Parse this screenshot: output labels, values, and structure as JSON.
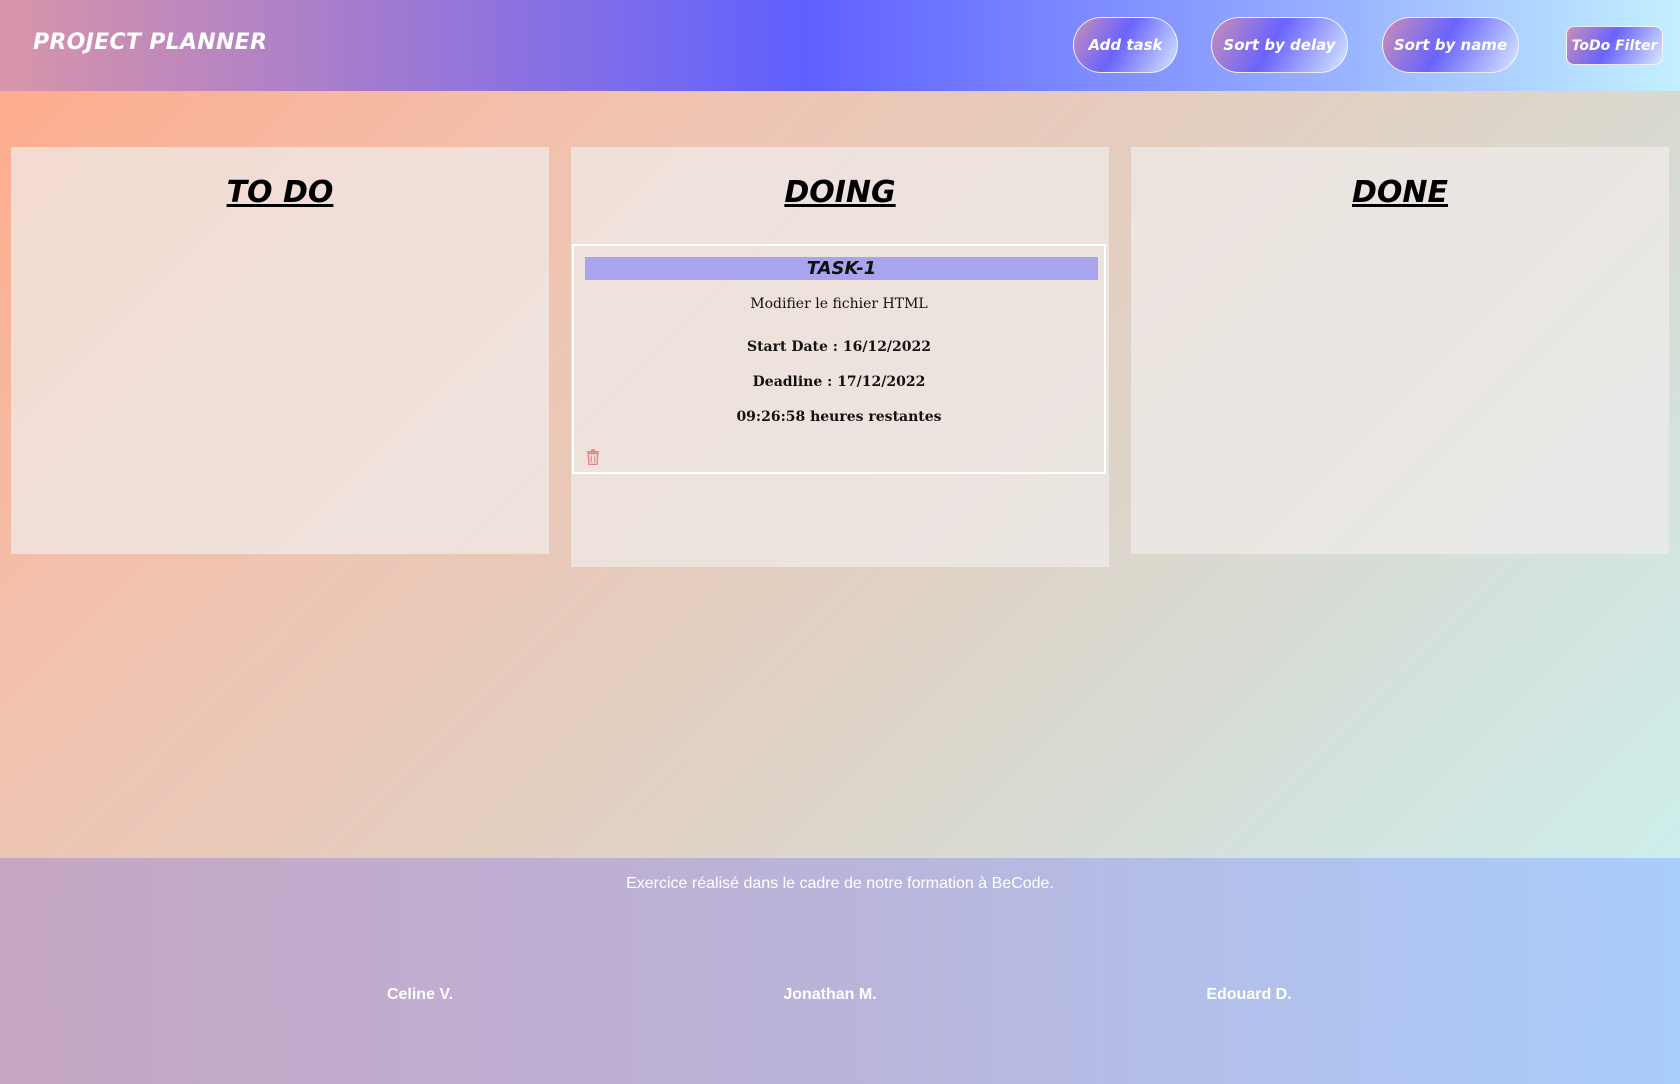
{
  "header": {
    "logo": "PROJECT PLANNER",
    "buttons": {
      "add_task": "Add task",
      "sort_delay": "Sort by delay",
      "sort_name": "Sort by name",
      "todo_filter": "ToDo Filter"
    }
  },
  "columns": {
    "todo": {
      "title": "TO DO"
    },
    "doing": {
      "title": "DOING",
      "tasks": [
        {
          "title": "TASK-1",
          "description": "Modifier le fichier HTML",
          "start_date": "Start Date : 16/12/2022",
          "deadline": "Deadline : 17/12/2022",
          "remaining": "09:26:58 heures restantes",
          "delete_icon": "trash-icon"
        }
      ]
    },
    "done": {
      "title": "DONE"
    }
  },
  "footer": {
    "text": "Exercice réalisé dans le cadre de notre formation à BeCode.",
    "authors": [
      "Celine V.",
      "Jonathan M.",
      "Edouard D."
    ]
  },
  "colors": {
    "task_title_bg": "#a9a4ee",
    "delete_icon": "#e8828a"
  }
}
